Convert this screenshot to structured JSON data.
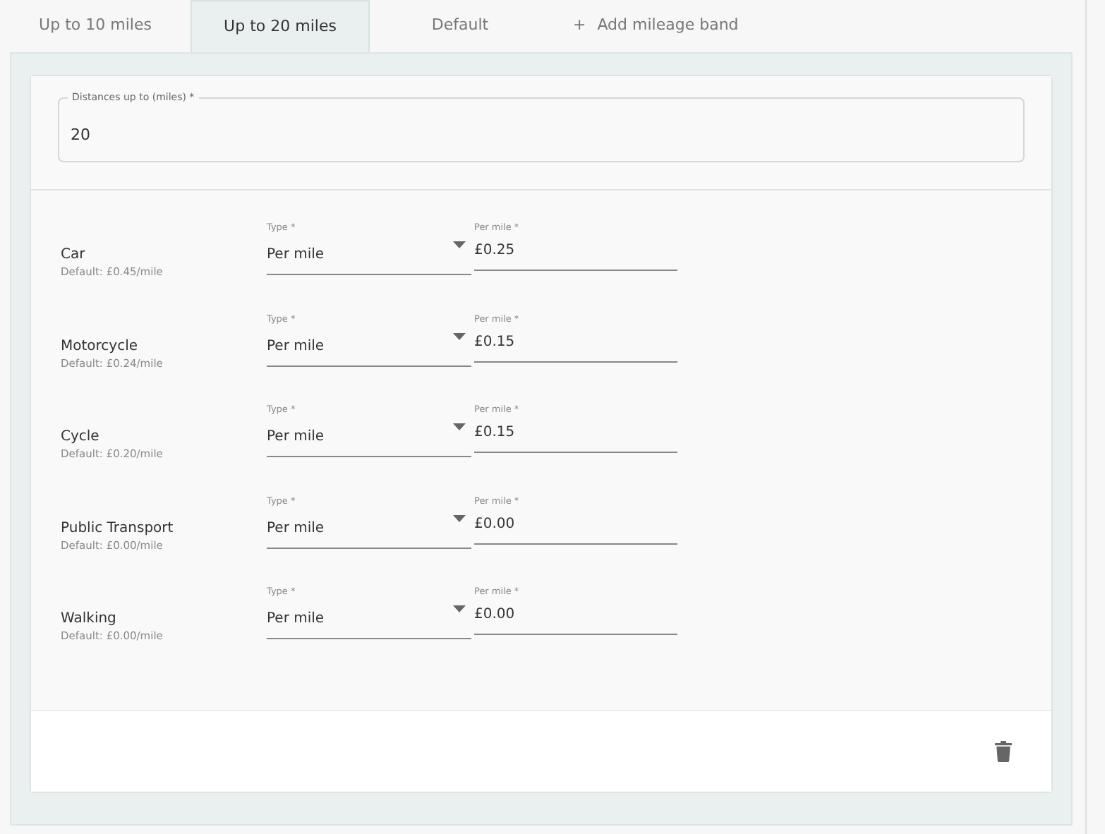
{
  "tabs": [
    {
      "label": "Up to 10 miles",
      "selected": false
    },
    {
      "label": "Up to 20 miles",
      "selected": true
    },
    {
      "label": "Default",
      "selected": false
    }
  ],
  "add_tab": {
    "icon": "+",
    "label": "Add mileage band"
  },
  "distance_field": {
    "label": "Distances up to (miles) *",
    "value": "20"
  },
  "vehicles": [
    {
      "name": "Car",
      "default": "Default: £0.45/mile",
      "type_label": "Type *",
      "type_value": "Per mile",
      "rate_label": "Per mile *",
      "rate_value": "£0.25"
    },
    {
      "name": "Motorcycle",
      "default": "Default: £0.24/mile",
      "type_label": "Type *",
      "type_value": "Per mile",
      "rate_label": "Per mile *",
      "rate_value": "£0.15"
    },
    {
      "name": "Cycle",
      "default": "Default: £0.20/mile",
      "type_label": "Type *",
      "type_value": "Per mile",
      "rate_label": "Per mile *",
      "rate_value": "£0.15"
    },
    {
      "name": "Public Transport",
      "default": "Default: £0.00/mile",
      "type_label": "Type *",
      "type_value": "Per mile",
      "rate_label": "Per mile *",
      "rate_value": "£0.00"
    },
    {
      "name": "Walking",
      "default": "Default: £0.00/mile",
      "type_label": "Type *",
      "type_value": "Per mile",
      "rate_label": "Per mile *",
      "rate_value": "£0.00"
    }
  ]
}
